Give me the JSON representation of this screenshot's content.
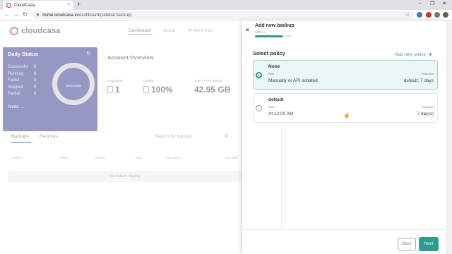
{
  "browser": {
    "tab_title": "CloudCasa",
    "tab_close": "×",
    "new_tab": "+",
    "url_host": "home.cloudcasa.io",
    "url_path": "/dashboard/(sidebar:backup)",
    "minimize": "–",
    "maximize": "❐",
    "close": "✕"
  },
  "app": {
    "logo": "cloudcasa",
    "nav": [
      "Dashboard",
      "Setup",
      "Preferences"
    ],
    "daily_status": {
      "title": "Daily Status",
      "stats": [
        {
          "label": "Successful",
          "value": "0"
        },
        {
          "label": "Running",
          "value": "0"
        },
        {
          "label": "Failed",
          "value": "0"
        },
        {
          "label": "Skipped",
          "value": "0"
        },
        {
          "label": "Partial",
          "value": "0"
        }
      ],
      "donut_value": "-",
      "donut_label": "SUCCESS",
      "alerts": "Alerts →"
    },
    "overview": {
      "title": "Account Overview",
      "items": [
        {
          "label": "Registered",
          "value": "1"
        },
        {
          "label": "Healthy",
          "value": "100%"
        },
        {
          "label": "Total PVs Protected",
          "value": "42.95 GB"
        }
      ]
    },
    "backups_tabs": [
      "Backups",
      "Restores"
    ],
    "search_placeholder": "Search for backup",
    "columns": [
      "Name ⇕",
      "Policy",
      "Cluster",
      "Type",
      "Last Run ⇕",
      "Last Mod"
    ],
    "no_data": "No data to display"
  },
  "drawer": {
    "close_label": "×",
    "title": "Add new backup",
    "step": "STEP 3",
    "progress": 0.75,
    "section_title": "Select policy",
    "add_policy": "Add new policy",
    "add_policy_icon": "+",
    "policies": [
      {
        "name": "None",
        "rule_label": "Rule",
        "schedule": "Manually or API initiated",
        "retention_label": "Retention",
        "retention": "default: 7 days",
        "selected": true
      },
      {
        "name": "default",
        "rule_label": "Rule",
        "schedule": "At 12:00 AM",
        "retention_label": "Retention",
        "retention": "7 day(s)",
        "selected": false
      }
    ],
    "back_label": "Back",
    "next_label": "Next"
  },
  "colors": {
    "accent": "#2a9d8f",
    "brand": "#c2185b",
    "status_panel": "#2d3189"
  }
}
